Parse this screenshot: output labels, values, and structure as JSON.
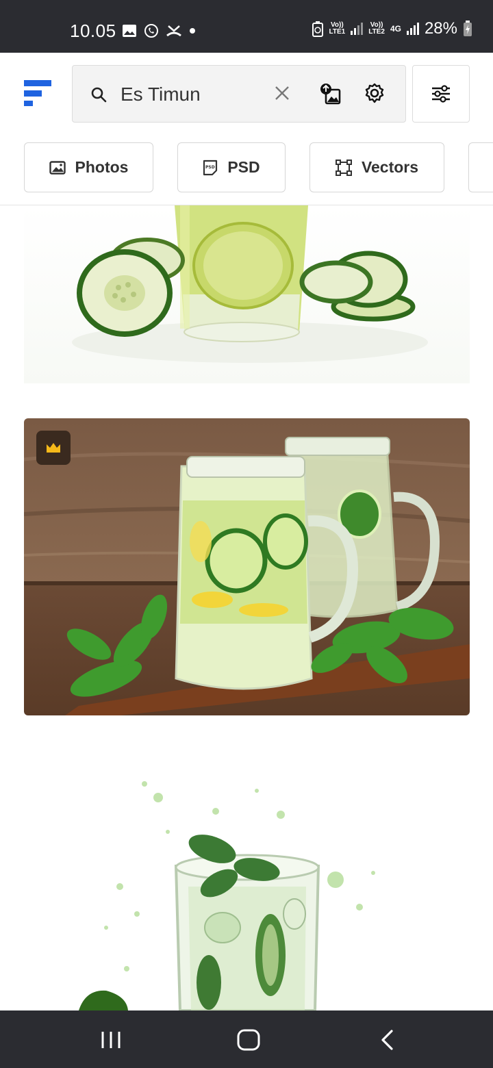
{
  "status_bar": {
    "time": "10.05",
    "net1_top": "Vo))",
    "net1_bottom": "LTE1",
    "net2_top": "Vo))",
    "net2_bottom": "LTE2",
    "net2_type": "4G",
    "battery": "28%"
  },
  "search": {
    "query": "Es Timun",
    "placeholder": ""
  },
  "filters": [
    {
      "label": "Photos",
      "icon": "image-icon"
    },
    {
      "label": "PSD",
      "icon": "psd-file-icon"
    },
    {
      "label": "Vectors",
      "icon": "vector-icon"
    }
  ],
  "results": [
    {
      "subject": "cucumber-water-glass",
      "premium": false
    },
    {
      "subject": "cucumber-lemon-mint-jars",
      "premium": true
    },
    {
      "subject": "watercolor-cucumber-mint-drink",
      "premium": false
    }
  ],
  "colors": {
    "brand": "#1f63e0",
    "premium_crown": "#f6b91a",
    "system_bar": "#2b2c31"
  }
}
